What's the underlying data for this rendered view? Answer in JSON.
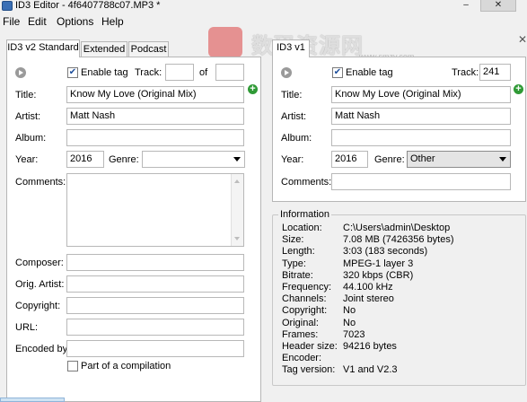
{
  "window": {
    "title": "ID3 Editor - 4f6407788c07.MP3 *",
    "minimize": "–",
    "close": "✕"
  },
  "menu": [
    "File",
    "Edit",
    "Options",
    "Help"
  ],
  "left_tabs": [
    "ID3 v2 Standard",
    "Extended",
    "Podcast"
  ],
  "left": {
    "enable_tag_label": "Enable tag",
    "enable_tag_checked": true,
    "track_label": "Track:",
    "track_value": "",
    "of_label": "of",
    "of_value": "",
    "title_label": "Title:",
    "title_value": "Know My Love (Original Mix)",
    "artist_label": "Artist:",
    "artist_value": "Matt Nash",
    "album_label": "Album:",
    "album_value": "",
    "year_label": "Year:",
    "year_value": "2016",
    "genre_label": "Genre:",
    "genre_value": "",
    "comments_label": "Comments:",
    "comments_value": "",
    "composer_label": "Composer:",
    "composer_value": "",
    "orig_artist_label": "Orig. Artist:",
    "orig_artist_value": "",
    "copyright_label": "Copyright:",
    "copyright_value": "",
    "url_label": "URL:",
    "url_value": "",
    "encoded_by_label": "Encoded by:",
    "encoded_by_value": "",
    "compilation_label": "Part of a compilation",
    "compilation_checked": false
  },
  "right_tab": "ID3 v1",
  "right": {
    "enable_tag_label": "Enable tag",
    "enable_tag_checked": true,
    "track_label": "Track:",
    "track_value": "241",
    "title_label": "Title:",
    "title_value": "Know My Love (Original Mix)",
    "artist_label": "Artist:",
    "artist_value": "Matt Nash",
    "album_label": "Album:",
    "album_value": "",
    "year_label": "Year:",
    "year_value": "2016",
    "genre_label": "Genre:",
    "genre_value": "Other",
    "comments_label": "Comments:",
    "comments_value": ""
  },
  "information": {
    "header": "Information",
    "rows": [
      {
        "key": "Location:",
        "value": "C:\\Users\\admin\\Desktop"
      },
      {
        "key": "Size:",
        "value": "7.08 MB (7426356 bytes)"
      },
      {
        "key": "Length:",
        "value": "3:03 (183 seconds)"
      },
      {
        "key": "Type:",
        "value": "MPEG-1 layer 3"
      },
      {
        "key": "Bitrate:",
        "value": "320 kbps (CBR)"
      },
      {
        "key": "Frequency:",
        "value": "44.100 kHz"
      },
      {
        "key": "Channels:",
        "value": "Joint stereo"
      },
      {
        "key": "Copyright:",
        "value": "No"
      },
      {
        "key": "Original:",
        "value": "No"
      },
      {
        "key": "Frames:",
        "value": "7023"
      },
      {
        "key": "Header size:",
        "value": "94216 bytes"
      },
      {
        "key": "Encoder:",
        "value": ""
      },
      {
        "key": "Tag version:",
        "value": "V1 and V2.3"
      }
    ]
  },
  "watermark": {
    "text": "数码资源网",
    "sub": "www.smzy.com"
  },
  "icons": {
    "play": "play-icon",
    "add": "plus-icon",
    "dropdown": "chevron-down-icon",
    "app": "app-icon"
  }
}
